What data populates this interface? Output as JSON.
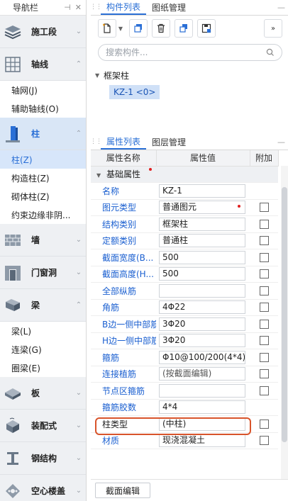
{
  "nav": {
    "title": "导航栏",
    "items": [
      {
        "type": "cat",
        "label": "施工段",
        "chevron": "⌄",
        "icon": "layers-icon",
        "active": false
      },
      {
        "type": "cat",
        "label": "轴线",
        "chevron": "⌃",
        "icon": "grid-axis-icon",
        "active": false
      },
      {
        "type": "sub",
        "label": "轴网(J)"
      },
      {
        "type": "sub",
        "label": "辅助轴线(O)"
      },
      {
        "type": "cat",
        "label": "柱",
        "chevron": "⌃",
        "icon": "column-icon",
        "active": true
      },
      {
        "type": "sub",
        "label": "柱(Z)",
        "selected": true
      },
      {
        "type": "sub",
        "label": "构造柱(Z)"
      },
      {
        "type": "sub",
        "label": "砌体柱(Z)"
      },
      {
        "type": "sub",
        "label": "约束边缘非阴..."
      },
      {
        "type": "cat",
        "label": "墙",
        "chevron": "⌄",
        "icon": "wall-icon",
        "active": false
      },
      {
        "type": "cat",
        "label": "门窗洞",
        "chevron": "⌄",
        "icon": "door-window-icon",
        "active": false
      },
      {
        "type": "cat",
        "label": "梁",
        "chevron": "⌃",
        "icon": "beam-icon",
        "active": false
      },
      {
        "type": "sub",
        "label": "梁(L)"
      },
      {
        "type": "sub",
        "label": "连梁(G)"
      },
      {
        "type": "sub",
        "label": "圈梁(E)"
      },
      {
        "type": "cat",
        "label": "板",
        "chevron": "⌄",
        "icon": "slab-icon",
        "active": false
      },
      {
        "type": "cat",
        "label": "装配式",
        "chevron": "⌄",
        "icon": "prefab-icon",
        "active": false
      },
      {
        "type": "cat",
        "label": "钢结构",
        "chevron": "⌄",
        "icon": "steel-beam-icon",
        "active": false
      },
      {
        "type": "cat",
        "label": "空心楼盖",
        "chevron": "⌄",
        "icon": "hollow-floor-icon",
        "active": false
      }
    ]
  },
  "component_pane": {
    "tabs": [
      "构件列表",
      "图纸管理"
    ],
    "search_placeholder": "搜索构件...",
    "tree_parent": "框架柱",
    "tree_leaf": "KZ-1 <0>"
  },
  "property_pane": {
    "tabs": [
      "属性列表",
      "图层管理"
    ],
    "headers": [
      "属性名称",
      "属性值",
      "附加"
    ],
    "group": "基础属性",
    "rows": [
      {
        "name": "名称",
        "value": "KZ-1",
        "link": true,
        "checkbox": false,
        "hint": false,
        "dot": false
      },
      {
        "name": "图元类型",
        "value": "普通图元",
        "link": true,
        "checkbox": true,
        "hint": false,
        "dot": true
      },
      {
        "name": "结构类别",
        "value": "框架柱",
        "link": true,
        "checkbox": true,
        "hint": false,
        "dot": false
      },
      {
        "name": "定额类别",
        "value": "普通柱",
        "link": true,
        "checkbox": true,
        "hint": false,
        "dot": false
      },
      {
        "name": "截面宽度(B...",
        "value": "500",
        "link": true,
        "checkbox": true,
        "hint": false,
        "dot": false
      },
      {
        "name": "截面高度(H...",
        "value": "500",
        "link": true,
        "checkbox": true,
        "hint": false,
        "dot": false
      },
      {
        "name": "全部纵筋",
        "value": "",
        "link": true,
        "checkbox": true,
        "hint": false,
        "dot": false
      },
      {
        "name": "角筋",
        "value": "4Φ22",
        "link": true,
        "checkbox": true,
        "hint": false,
        "dot": false
      },
      {
        "name": "B边一侧中部筋",
        "value": "3Φ20",
        "link": true,
        "checkbox": true,
        "hint": false,
        "dot": false
      },
      {
        "name": "H边一侧中部筋",
        "value": "3Φ20",
        "link": true,
        "checkbox": true,
        "hint": false,
        "dot": false
      },
      {
        "name": "箍筋",
        "value": "Φ10@100/200(4*4)",
        "link": true,
        "checkbox": true,
        "hint": false,
        "dot": false
      },
      {
        "name": "连接植筋",
        "value": "(按截面编辑)",
        "link": true,
        "checkbox": true,
        "hint": true,
        "dot": false
      },
      {
        "name": "节点区箍筋",
        "value": "",
        "link": true,
        "checkbox": true,
        "hint": false,
        "dot": false
      },
      {
        "name": "箍筋胶数",
        "value": "4*4",
        "link": true,
        "checkbox": false,
        "hint": false,
        "dot": false
      },
      {
        "name": "柱类型",
        "value": "(中柱)",
        "link": false,
        "checkbox": true,
        "hint": false,
        "dot": false
      },
      {
        "name": "材质",
        "value": "现浇混凝土",
        "link": true,
        "checkbox": true,
        "hint": false,
        "dot": false
      }
    ],
    "footer_button": "截面编辑"
  },
  "colors": {
    "accent": "#2a6fd6",
    "link": "#1a5fd0",
    "highlight": "#d8542b"
  }
}
